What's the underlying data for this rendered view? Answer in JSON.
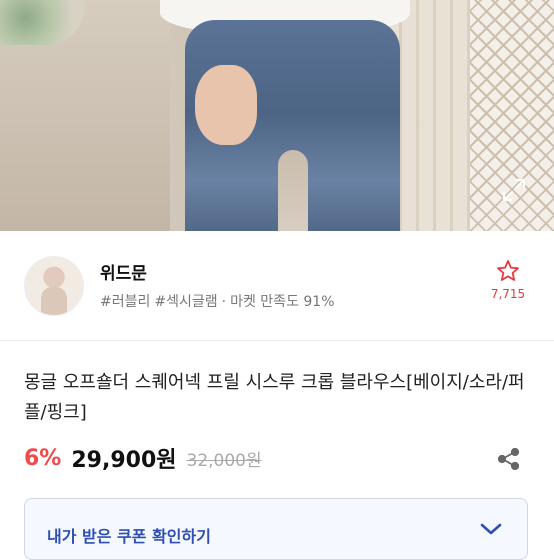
{
  "product_image": {
    "alt": "product photo - jeans"
  },
  "icons": {
    "expand": "expand-icon",
    "favorite": "star-outline-icon",
    "share": "share-icon",
    "coupon_toggle": "chevron-down-icon"
  },
  "seller": {
    "name": "위드문",
    "tag1": "#러블리",
    "tag2": "#섹시글램",
    "separator": "·",
    "satisfaction": "마켓 만족도 91%",
    "favorite_count": "7,715"
  },
  "product": {
    "title": "몽글 오프숄더 스퀘어넥 프릴 시스루 크롭 블라우스[베이지/소라/퍼플/핑크]",
    "discount": "6%",
    "price": "29,900원",
    "original_price": "32,000원"
  },
  "coupon": {
    "label": "내가 받은 쿠폰 확인하기"
  },
  "colors": {
    "accent_red": "#f04b4b",
    "coupon_blue": "#2f4fb3",
    "coupon_bg": "#f5f8ff"
  }
}
